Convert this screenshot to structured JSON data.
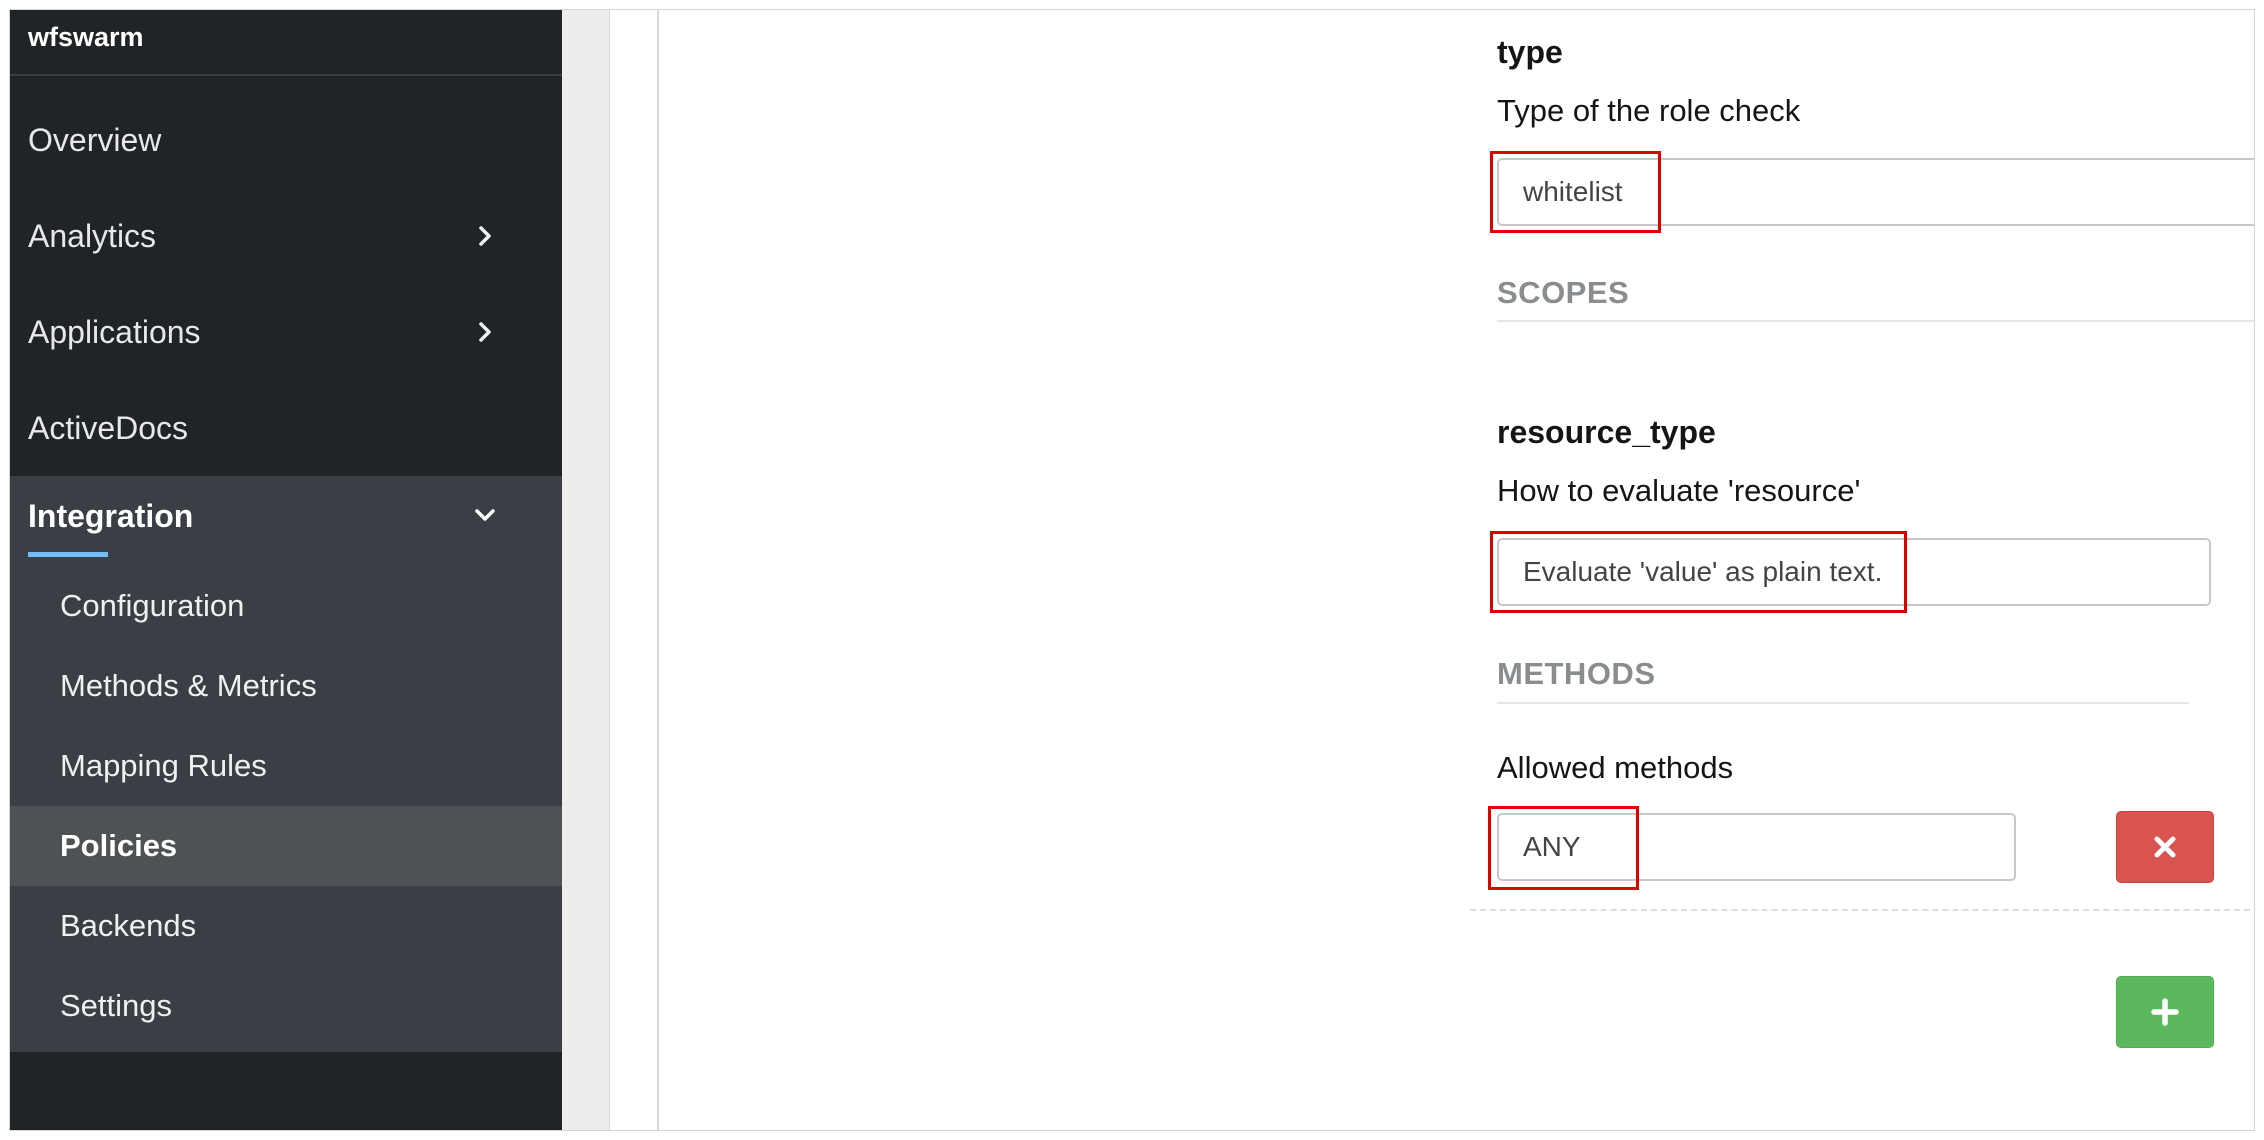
{
  "sidebar": {
    "brand": "wfswarm",
    "items": [
      {
        "label": "Overview"
      },
      {
        "label": "Analytics"
      },
      {
        "label": "Applications"
      },
      {
        "label": "ActiveDocs"
      }
    ],
    "integration": {
      "label": "Integration",
      "sub_items": [
        {
          "label": "Configuration"
        },
        {
          "label": "Methods & Metrics"
        },
        {
          "label": "Mapping Rules"
        },
        {
          "label": "Policies",
          "active": true
        },
        {
          "label": "Backends"
        },
        {
          "label": "Settings"
        }
      ]
    }
  },
  "form": {
    "type": {
      "title": "type",
      "description": "Type of the role check",
      "value": "whitelist"
    },
    "scopes_heading": "SCOPES",
    "resource_type": {
      "title": "resource_type",
      "description": "How to evaluate 'resource'",
      "value": "Evaluate 'value' as plain text."
    },
    "methods_heading": "METHODS",
    "allowed_methods": {
      "label": "Allowed methods",
      "value": "ANY"
    }
  },
  "colors": {
    "sidebar_bg": "#212427",
    "sidebar_sub_bg": "#393f44",
    "active_item_bg": "#4f5255",
    "active_underline": "#73bcf7",
    "highlight_box": "#e00000",
    "danger_button": "#d9534f",
    "success_button": "#5cb85c"
  },
  "icons": {
    "expand": "chevron-right-icon",
    "collapse": "chevron-down-icon",
    "remove": "close-icon",
    "add": "plus-icon"
  }
}
